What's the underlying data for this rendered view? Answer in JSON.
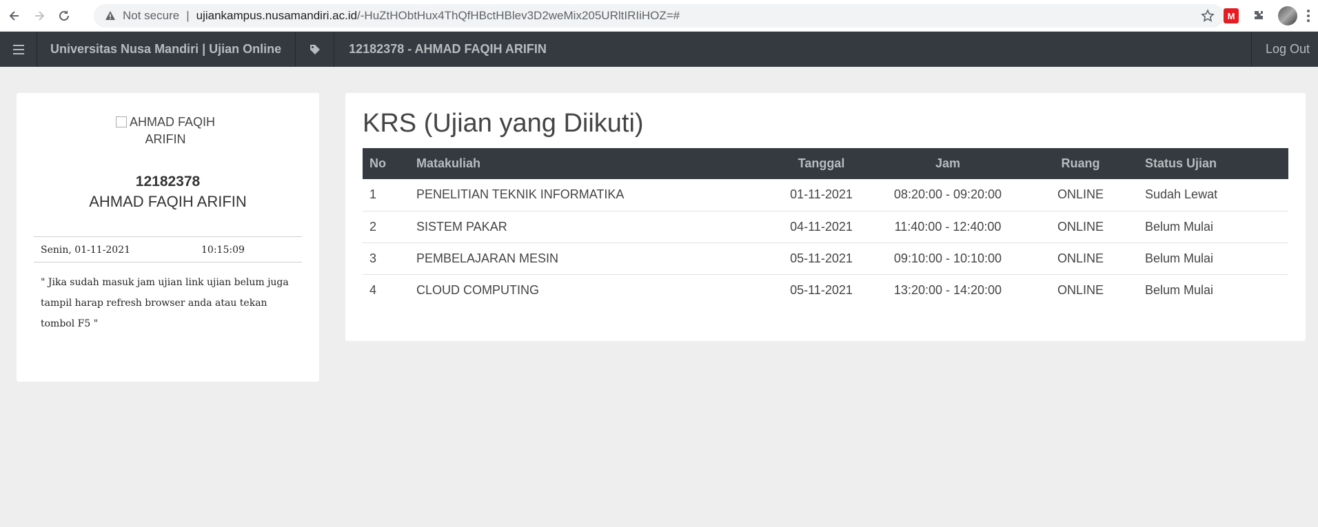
{
  "browser": {
    "security_label": "Not secure",
    "url_host": "ujiankampus.nusamandiri.ac.id",
    "url_path": "/-HuZtHObtHux4ThQfHBctHBlev3D2weMix205URltIRIiHOZ=#",
    "extension_badge": "M",
    "icons": [
      "back-arrow-icon",
      "forward-arrow-icon",
      "reload-icon",
      "warning-icon",
      "star-icon",
      "extension-icon",
      "puzzle-icon",
      "profile-avatar",
      "menu-dots-icon"
    ]
  },
  "navbar": {
    "brand": "Universitas Nusa Mandiri | Ujian Online",
    "user": "12182378 - AHMAD FAQIH ARIFIN",
    "logout": "Log Out",
    "bg_color": "#343a40"
  },
  "profile": {
    "image_alt": "AHMAD FAQIH ARIFIN",
    "nim": "12182378",
    "name": "AHMAD FAQIH ARIFIN",
    "date": "Senin, 01-11-2021",
    "time": "10:15:09",
    "note": "\" Jika sudah masuk jam ujian link ujian belum juga tampil harap refresh browser anda atau tekan tombol F5 \""
  },
  "main": {
    "title": "KRS (Ujian yang Diikuti)",
    "table": {
      "headers": [
        "No",
        "Matakuliah",
        "Tanggal",
        "Jam",
        "Ruang",
        "Status Ujian"
      ],
      "rows": [
        [
          "1",
          "PENELITIAN TEKNIK INFORMATIKA",
          "01-11-2021",
          "08:20:00 - 09:20:00",
          "ONLINE",
          "Sudah Lewat"
        ],
        [
          "2",
          "SISTEM PAKAR",
          "04-11-2021",
          "11:40:00 - 12:40:00",
          "ONLINE",
          "Belum Mulai"
        ],
        [
          "3",
          "PEMBELAJARAN MESIN",
          "05-11-2021",
          "09:10:00 - 10:10:00",
          "ONLINE",
          "Belum Mulai"
        ],
        [
          "4",
          "CLOUD COMPUTING",
          "05-11-2021",
          "13:20:00 - 14:20:00",
          "ONLINE",
          "Belum Mulai"
        ]
      ]
    }
  }
}
